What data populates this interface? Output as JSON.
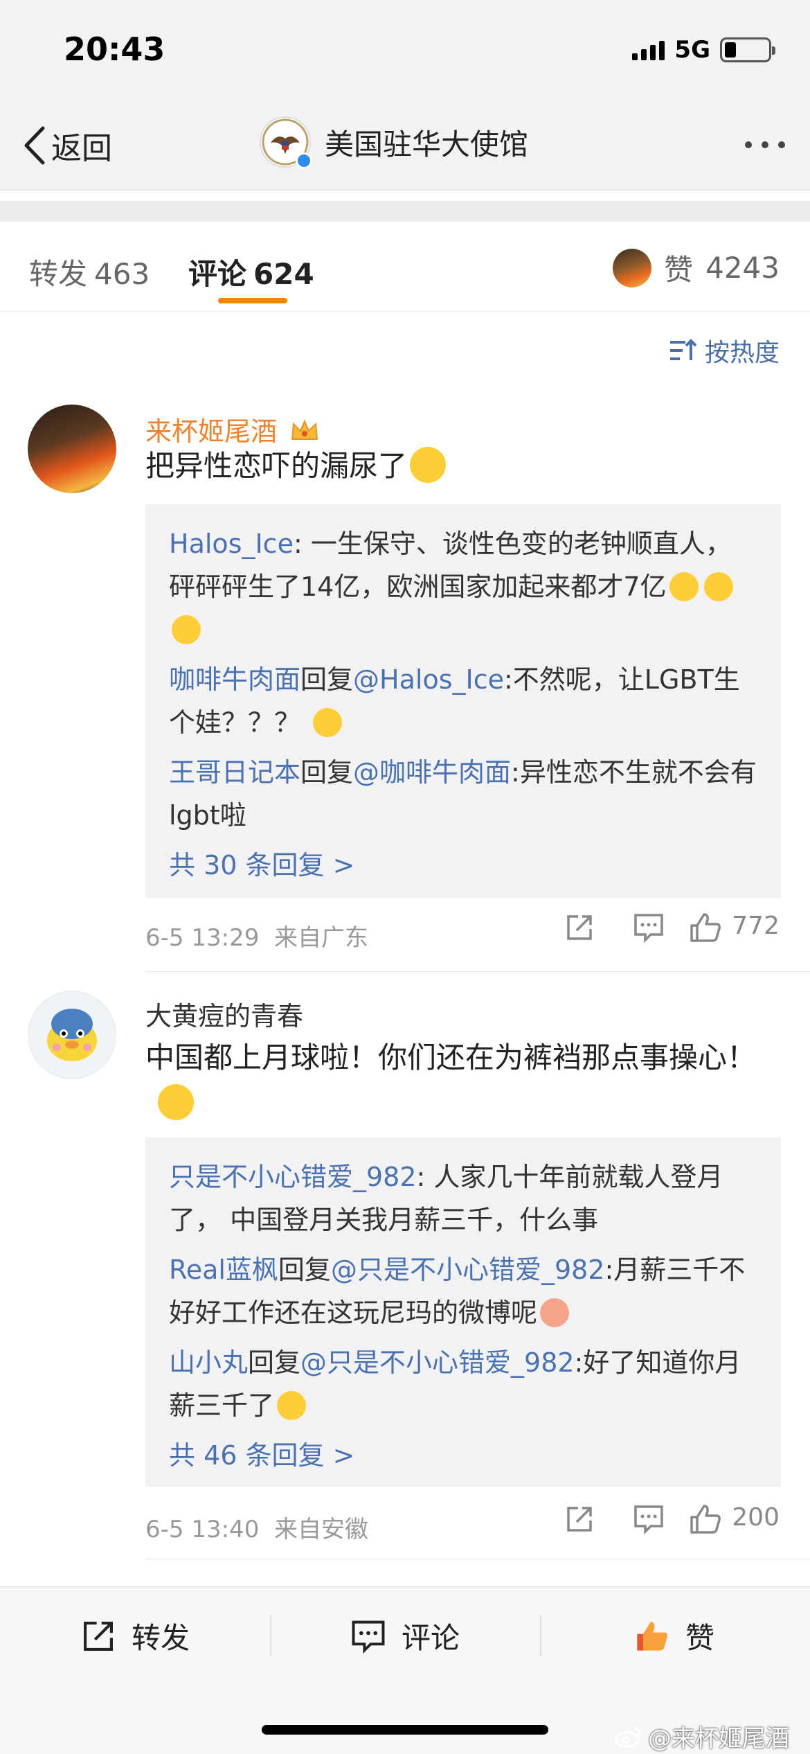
{
  "status_bar": {
    "time": "20:43",
    "network": "5G"
  },
  "nav": {
    "back_label": "返回",
    "title": "美国驻华大使馆"
  },
  "tabs": {
    "repost_label": "转发",
    "repost_count": "463",
    "comment_label": "评论",
    "comment_count": "624",
    "like_label": "赞",
    "like_count": "4243",
    "accent_color": "#ff8200"
  },
  "sort_label": "按热度",
  "comments": [
    {
      "username": "来杯姬尾酒",
      "username_color": "#f0822e",
      "text": "把异性恋吓的漏尿了",
      "replies": [
        {
          "user": "Halos_Ice",
          "sep": ": ",
          "text": "一生保守、谈性色变的老钟顺直人，砰砰砰生了14亿，欧洲国家加起来都才7亿"
        },
        {
          "user": "咖啡牛肉面",
          "mid": "回复",
          "target": "@Halos_Ice",
          "sep": ":",
          "text": "不然呢，让LGBT生个娃？？？"
        },
        {
          "user": "王哥日记本",
          "mid": "回复",
          "target": "@咖啡牛肉面",
          "sep": ":",
          "text": "异性恋不生就不会有lgbt啦"
        }
      ],
      "more_replies": "共 30 条回复 >",
      "time": "6-5 13:29",
      "source": "来自广东",
      "likes": "772"
    },
    {
      "username": "大黄痘的青春",
      "username_color": "#333333",
      "text": "中国都上月球啦！你们还在为裤裆那点事操心！",
      "replies": [
        {
          "user": "只是不小心错爱_982",
          "sep": ": ",
          "text": "人家几十年前就载人登月了， 中国登月关我月薪三千，什么事"
        },
        {
          "user": "Real蓝枫",
          "mid": "回复",
          "target": "@只是不小心错爱_982",
          "sep": ":",
          "text": "月薪三千不好好工作还在这玩尼玛的微博呢"
        },
        {
          "user": "山小丸",
          "mid": "回复",
          "target": "@只是不小心错爱_982",
          "sep": ":",
          "text": "好了知道你月薪三千了"
        }
      ],
      "more_replies": "共 46 条回复 >",
      "time": "6-5 13:40",
      "source": "来自安徽",
      "likes": "200"
    }
  ],
  "bottom_bar": {
    "repost": "转发",
    "comment": "评论",
    "like": "赞"
  },
  "watermark": "@来杯姬尾酒"
}
